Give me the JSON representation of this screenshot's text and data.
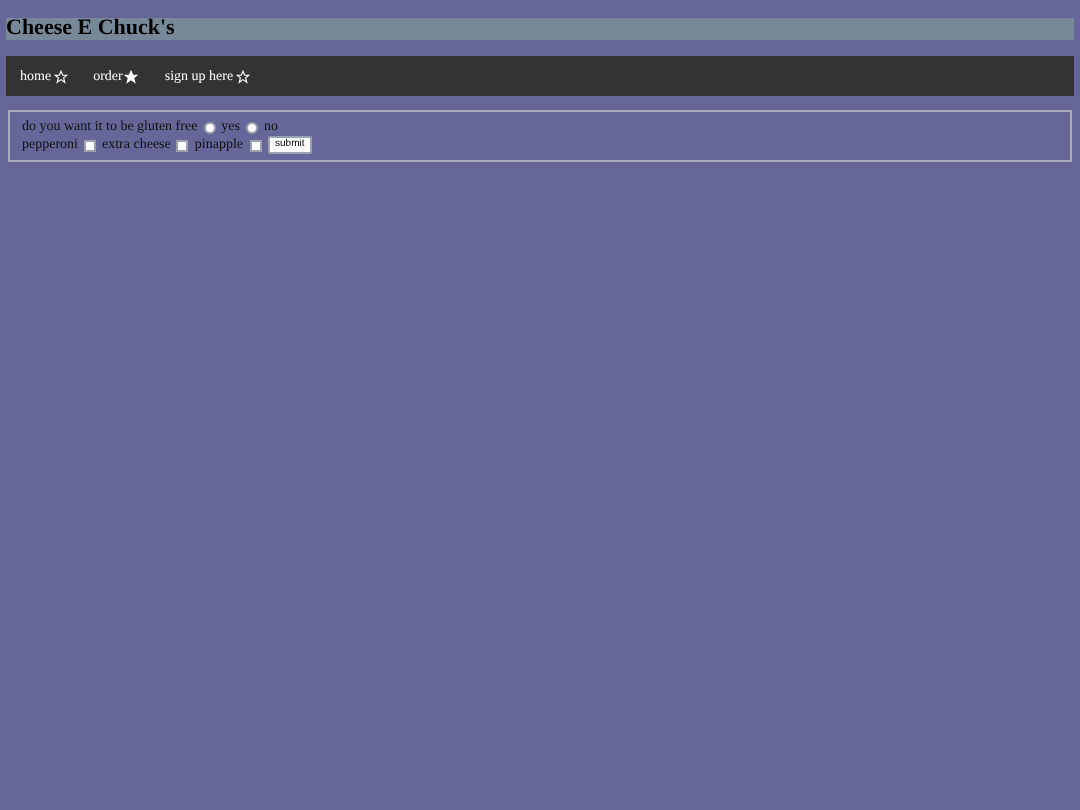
{
  "header": {
    "title": "Cheese E Chuck's"
  },
  "nav": [
    {
      "label": "home",
      "selected": false
    },
    {
      "label": "order",
      "selected": true
    },
    {
      "label": "sign up here",
      "selected": false
    }
  ],
  "form": {
    "question": "do you want it to be gluten free",
    "radios": [
      {
        "label": "yes",
        "selected": false
      },
      {
        "label": "no",
        "selected": false
      }
    ],
    "toppings": [
      {
        "label": "pepperoni",
        "checked": false
      },
      {
        "label": "extra cheese",
        "checked": false
      },
      {
        "label": "pinapple",
        "checked": false
      }
    ],
    "submit": "submit"
  }
}
